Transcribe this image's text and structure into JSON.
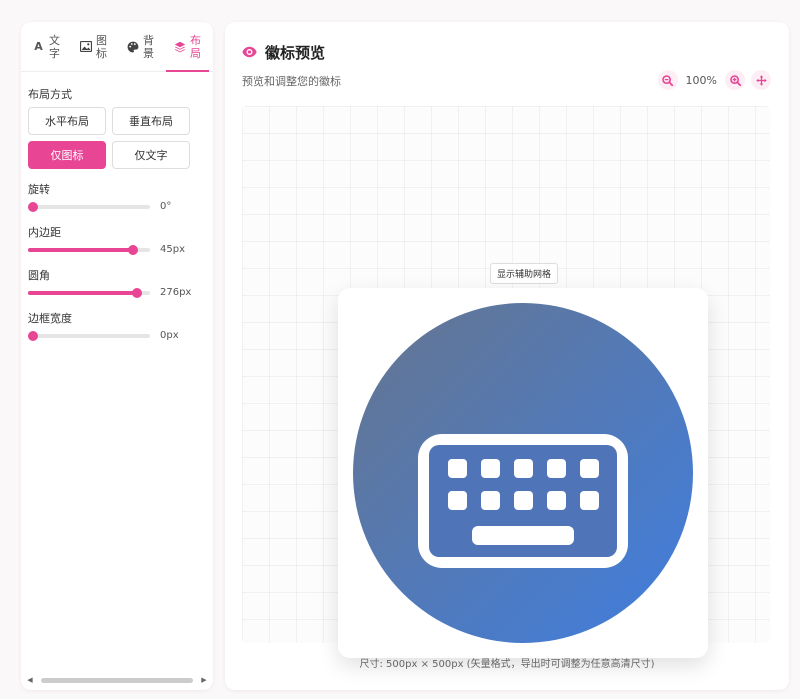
{
  "tabs": [
    {
      "icon": "A",
      "label": "文字"
    },
    {
      "icon": "image-icon",
      "label": "图标"
    },
    {
      "icon": "palette-icon",
      "label": "背景"
    },
    {
      "icon": "layers-icon",
      "label": "布局"
    }
  ],
  "active_tab": 3,
  "layout": {
    "title": "布局方式",
    "options": [
      "水平布局",
      "垂直布局",
      "仅图标",
      "仅文字"
    ],
    "selected": "仅图标"
  },
  "sliders": {
    "rotation": {
      "label": "旋转",
      "value": "0°",
      "fraction": 0.0
    },
    "padding": {
      "label": "内边距",
      "value": "45px",
      "fraction": 0.86
    },
    "radius": {
      "label": "圆角",
      "value": "276px",
      "fraction": 0.89
    },
    "border": {
      "label": "边框宽度",
      "value": "0px",
      "fraction": 0.0
    }
  },
  "preview": {
    "title": "徽标预览",
    "subtitle": "预览和调整您的徽标",
    "zoom": "100%",
    "grid_button": "显示辅助网格",
    "footer": "尺寸: 500px × 500px (矢量格式，导出时可调整为任意高清尺寸)",
    "gradient_start": "#66758e",
    "gradient_end": "#3f7ee0"
  },
  "colors": {
    "accent": "#e84595"
  }
}
